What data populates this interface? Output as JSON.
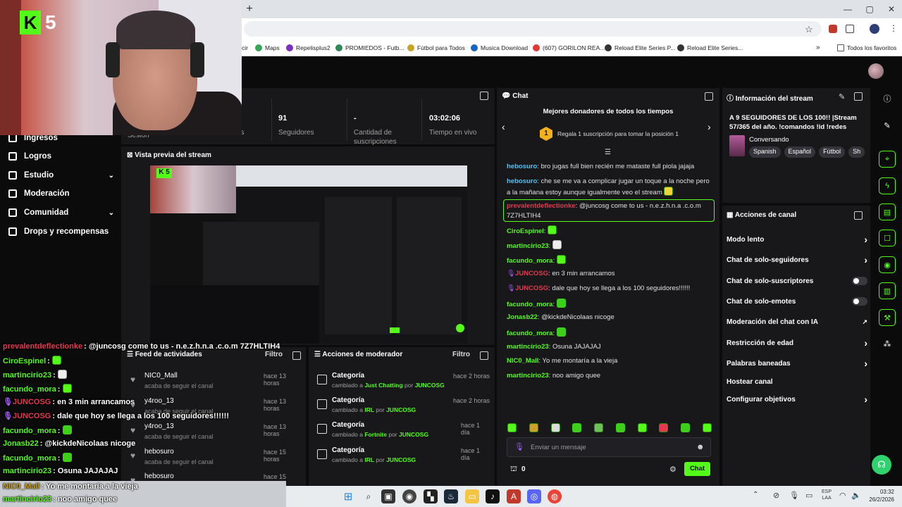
{
  "browser": {
    "new_tab": "+",
    "bookmarks": [
      {
        "label": "cir",
        "color": "#888"
      },
      {
        "label": "Maps",
        "color": "#34a853"
      },
      {
        "label": "Repelisplus2",
        "color": "#7b2fbe"
      },
      {
        "label": "PROMIEDOS - Futb...",
        "color": "#2e8b57"
      },
      {
        "label": "Fútbol para Todos",
        "color": "#c9a227"
      },
      {
        "label": "Musica Download",
        "color": "#1565c0"
      },
      {
        "label": "(607) GORILON REA...",
        "color": "#e53935"
      },
      {
        "label": "Reload Elite Series P...",
        "color": "#333"
      },
      {
        "label": "Reload Elite Series...",
        "color": "#333"
      }
    ],
    "all_favorites": "Todos los favoritos"
  },
  "webcam": {
    "logo_number": "5",
    "logo_letter": "K"
  },
  "sidebar": {
    "items": [
      {
        "label": "Ingresos"
      },
      {
        "label": "Logros"
      },
      {
        "label": "Estudio"
      },
      {
        "label": "Moderación"
      },
      {
        "label": "Comunidad"
      },
      {
        "label": "Drops y recompensas"
      }
    ]
  },
  "stats": {
    "session_label": "Sesión",
    "followers_label_partial": "es",
    "followers_value": "91",
    "followers_label": "Seguidores",
    "subs_value": "-",
    "subs_label_1": "Cantidad de",
    "subs_label_2": "suscripciones",
    "time_value": "03:02:06",
    "time_label": "Tiempo en vivo"
  },
  "preview": {
    "title": "Vista previa del stream"
  },
  "overlay_chat": [
    {
      "user": "prevalentdeflectionke",
      "color": "#e53950",
      "text": "@juncosg come to us - n.e.z.h.n.a .c.o.m 7Z7HLTIH4"
    },
    {
      "user": "CiroEspinel",
      "color": "#53fc18",
      "text": "",
      "emote": true
    },
    {
      "user": "martincirio23",
      "color": "#53fc18",
      "text": "",
      "emote2": true
    },
    {
      "user": "facundo_mora",
      "color": "#53fc18",
      "text": "",
      "emote": true
    },
    {
      "user": "JUNCOSG",
      "color": "#e53950",
      "text": "en 3 min arrancamos",
      "mic": true
    },
    {
      "user": "JUNCOSG",
      "color": "#e53950",
      "text": "dale que hoy se llega a los 100 seguidores!!!!!!",
      "mic": true
    },
    {
      "user": "facundo_mora",
      "color": "#53fc18",
      "text": "",
      "emote": true
    },
    {
      "user": "Jonasb22",
      "color": "#53fc18",
      "text": "@kickdeNicolaas nicoge"
    },
    {
      "user": "facundo_mora",
      "color": "#53fc18",
      "text": "",
      "emote": true
    },
    {
      "user": "martincirio23",
      "color": "#53fc18",
      "text": "Osuna JAJAJAJ"
    },
    {
      "user": "NIC0_Mall",
      "color": "#c9a227",
      "text": "Yo me montaría a la vieja"
    },
    {
      "user": "martincirio23",
      "color": "#53fc18",
      "text": "noo amigo quee"
    }
  ],
  "activity": {
    "title": "Feed de actividades",
    "filter": "Filtro",
    "items": [
      {
        "name": "NIC0_Mall",
        "sub": "acaba de seguir el canal",
        "time": "hace 13 horas"
      },
      {
        "name": "y4roo_13",
        "sub": "acaba de seguir el canal",
        "time": "hace 13 horas"
      },
      {
        "name": "y4roo_13",
        "sub": "acaba de seguir el canal",
        "time": "hace 13 horas"
      },
      {
        "name": "hebosuro",
        "sub": "acaba de seguir el canal",
        "time": "hace 15 horas"
      },
      {
        "name": "hebosuro",
        "sub": "",
        "time": "hace 15 horas"
      }
    ]
  },
  "mod_actions": {
    "title": "Acciones de moderador",
    "filter": "Filtro",
    "items": [
      {
        "title": "Categoría",
        "prefix": "cambiado a",
        "cat": "Just Chatting",
        "by": "por",
        "user": "JUNCOSG",
        "time": "hace 2 horas"
      },
      {
        "title": "Categoría",
        "prefix": "cambiado a",
        "cat": "IRL",
        "by": "por",
        "user": "JUNCOSG",
        "time": "hace 2 horas"
      },
      {
        "title": "Categoría",
        "prefix": "cambiado a",
        "cat": "Fortnite",
        "by": "por",
        "user": "JUNCOSG",
        "time": "hace 1 día"
      },
      {
        "title": "Categoría",
        "prefix": "cambiado a",
        "cat": "IRL",
        "by": "por",
        "user": "JUNCOSG",
        "time": "hace 1 día"
      }
    ]
  },
  "chat": {
    "title": "Chat",
    "donors_title": "Mejores donadores de todos los tiempos",
    "donor_rank": "1",
    "donor_text": "Regala 1 suscripción para tomar la posición 1",
    "messages": [
      {
        "user": "hebosuro",
        "color": "#4fc3f7",
        "text": "bro jugas full bien recién me mataste full piola jajaja"
      },
      {
        "user": "hebosuro",
        "color": "#4fc3f7",
        "text": "che se me va a complicar jugar un toque a la noche pero a la mañana estoy aunque igualmente veo el stream"
      },
      {
        "user": "prevalentdeflectionke",
        "color": "#e53950",
        "text": "@juncosg come to us - n.e.z.h.n.a .c.o.m 7Z7HLTIH4"
      },
      {
        "user": "CiroEspinel",
        "color": "#53fc18",
        "text": ""
      },
      {
        "user": "martincirio23",
        "color": "#53fc18",
        "text": ""
      },
      {
        "user": "facundo_mora",
        "color": "#53fc18",
        "text": ""
      },
      {
        "user": "JUNCOSG",
        "color": "#e53950",
        "text": "en 3 min arrancamos"
      },
      {
        "user": "JUNCOSG",
        "color": "#e53950",
        "text": "dale que hoy se llega a los 100 seguidores!!!!!!"
      },
      {
        "user": "facundo_mora",
        "color": "#53fc18",
        "text": ""
      },
      {
        "user": "Jonasb22",
        "color": "#53fc18",
        "text": "@kickdeNicolaas nicoge"
      },
      {
        "user": "facundo_mora",
        "color": "#53fc18",
        "text": ""
      },
      {
        "user": "martincirio23",
        "color": "#53fc18",
        "text": "Osuna JAJAJAJ"
      },
      {
        "user": "NIC0_Mall",
        "color": "#53fc18",
        "text": "Yo me montaría a la vieja"
      },
      {
        "user": "martincirio23",
        "color": "#53fc18",
        "text": "noo amigo quee"
      }
    ],
    "input_placeholder": "Enviar un mensaje",
    "points": "0",
    "send_label": "Chat"
  },
  "stream_info": {
    "title": "Información del stream",
    "stream_title": "A 9 SEGUIDORES DE LOS 100!! |Stream 57/365 del año. !comandos !id !redes",
    "category": "Conversando",
    "tags": [
      "Spanish",
      "Español",
      "Fútbol",
      "Sh"
    ]
  },
  "channel_actions": {
    "title": "Acciones de canal",
    "items": [
      {
        "label": "Modo lento",
        "kind": "chevron"
      },
      {
        "label": "Chat de solo-seguidores",
        "kind": "chevron"
      },
      {
        "label": "Chat de solo-suscriptores",
        "kind": "toggle"
      },
      {
        "label": "Chat de solo-emotes",
        "kind": "toggle"
      },
      {
        "label": "Moderación del chat con IA",
        "kind": "external"
      },
      {
        "label": "Restricción de edad",
        "kind": "chevron"
      },
      {
        "label": "Palabras baneadas",
        "kind": "chevron"
      },
      {
        "label": "Hostear canal",
        "kind": "none"
      },
      {
        "label": "Configurar objetivos",
        "kind": "chevron"
      }
    ]
  },
  "taskbar": {
    "lang_1": "ESP",
    "lang_2": "LAA",
    "time": "03:32",
    "date": "26/2/2026"
  },
  "colors": {
    "accent": "#53fc18",
    "panel": "#18181a",
    "bg": "#0b0b0c"
  }
}
